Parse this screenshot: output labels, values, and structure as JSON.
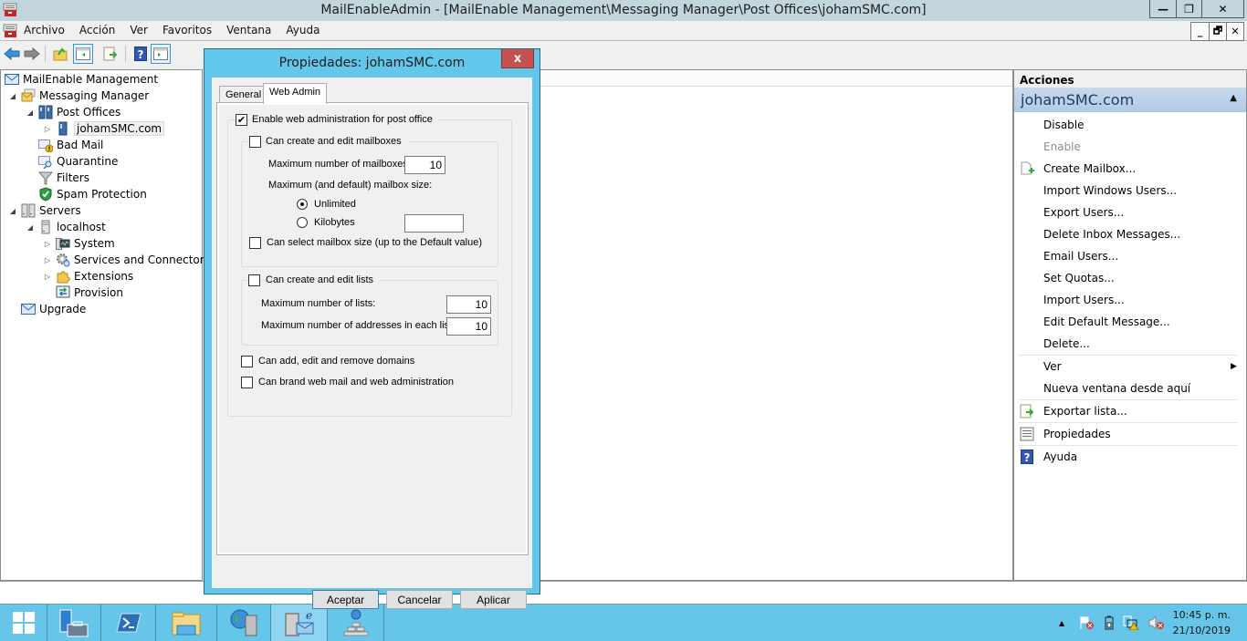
{
  "window": {
    "title": "MailEnableAdmin - [MailEnable Management\\Messaging Manager\\Post Offices\\johamSMC.com]",
    "controls": {
      "minimize": "—",
      "restore": "❐",
      "close": "✕"
    }
  },
  "menubar": {
    "items": [
      "Archivo",
      "Acción",
      "Ver",
      "Favoritos",
      "Ventana",
      "Ayuda"
    ],
    "mdi_controls": {
      "minimize": "_",
      "restore": "🗗",
      "close": "✕"
    }
  },
  "toolbar": {
    "buttons": [
      "back-arrow-icon",
      "forward-arrow-icon",
      "up-folder-icon",
      "show-hide-tree-icon",
      "export-list-icon",
      "help-icon",
      "show-hide-action-pane-icon"
    ]
  },
  "tree": {
    "nodes": [
      {
        "label": "MailEnable Management",
        "level": 0,
        "expander": "",
        "icon": "mailenable-icon"
      },
      {
        "label": "Messaging Manager",
        "level": 1,
        "expander": "◢",
        "icon": "messaging-icon"
      },
      {
        "label": "Post Offices",
        "level": 2,
        "expander": "◢",
        "icon": "post-offices-icon"
      },
      {
        "label": "johamSMC.com",
        "level": 3,
        "expander": "▷",
        "icon": "post-office-icon",
        "selected": true
      },
      {
        "label": "Bad Mail",
        "level": 2,
        "expander": "",
        "icon": "bad-mail-icon"
      },
      {
        "label": "Quarantine",
        "level": 2,
        "expander": "",
        "icon": "quarantine-icon"
      },
      {
        "label": "Filters",
        "level": 2,
        "expander": "",
        "icon": "filter-icon"
      },
      {
        "label": "Spam Protection",
        "level": 2,
        "expander": "",
        "icon": "shield-icon"
      },
      {
        "label": "Servers",
        "level": 1,
        "expander": "◢",
        "icon": "servers-icon"
      },
      {
        "label": "localhost",
        "level": 2,
        "expander": "◢",
        "icon": "server-icon"
      },
      {
        "label": "System",
        "level": 3,
        "expander": "▷",
        "icon": "system-icon"
      },
      {
        "label": "Services and Connectors",
        "level": 3,
        "expander": "▷",
        "icon": "gear-icon"
      },
      {
        "label": "Extensions",
        "level": 3,
        "expander": "▷",
        "icon": "puzzle-icon"
      },
      {
        "label": "Provision",
        "level": 3,
        "expander": "",
        "icon": "provision-icon"
      },
      {
        "label": "Upgrade",
        "level": 1,
        "expander": "",
        "icon": "mailenable-icon"
      }
    ]
  },
  "actions": {
    "header": "Acciones",
    "section_title": "johamSMC.com",
    "items": [
      {
        "label": "Disable",
        "icon": "",
        "disabled": false
      },
      {
        "label": "Enable",
        "icon": "",
        "disabled": true
      },
      {
        "label": "Create Mailbox...",
        "icon": "new-item-icon",
        "disabled": false
      },
      {
        "label": "Import Windows Users...",
        "icon": "",
        "disabled": false
      },
      {
        "label": "Export Users...",
        "icon": "",
        "disabled": false
      },
      {
        "label": "Delete Inbox Messages...",
        "icon": "",
        "disabled": false
      },
      {
        "label": "Email Users...",
        "icon": "",
        "disabled": false
      },
      {
        "label": "Set Quotas...",
        "icon": "",
        "disabled": false
      },
      {
        "label": "Import Users...",
        "icon": "",
        "disabled": false
      },
      {
        "label": "Edit Default Message...",
        "icon": "",
        "disabled": false
      },
      {
        "label": "Delete...",
        "icon": "",
        "disabled": false
      },
      {
        "label": "Ver",
        "icon": "",
        "disabled": false,
        "submenu": true
      },
      {
        "label": "Nueva ventana desde aquí",
        "icon": "",
        "disabled": false
      },
      {
        "label": "Exportar lista...",
        "icon": "export-list-icon",
        "disabled": false
      },
      {
        "label": "Propiedades",
        "icon": "properties-icon",
        "disabled": false
      },
      {
        "label": "Ayuda",
        "icon": "help-icon",
        "disabled": false
      }
    ]
  },
  "dialog": {
    "title": "Propiedades: johamSMC.com",
    "close_label": "x",
    "tabs": [
      {
        "label": "General",
        "active": false
      },
      {
        "label": "Web Admin",
        "active": true
      }
    ],
    "web_admin": {
      "enable_web_admin": {
        "label": "Enable web administration for post office",
        "checked": true
      },
      "mailboxes": {
        "label": "Can create and edit mailboxes",
        "checked": false,
        "max_mailboxes_label": "Maximum number of mailboxes:",
        "max_mailboxes_value": "10",
        "max_size_label": "Maximum (and default) mailbox size:",
        "unlimited_label": "Unlimited",
        "unlimited_selected": true,
        "kilobytes_label": "Kilobytes",
        "kilobytes_value": "",
        "select_size_label": "Can select mailbox size (up to the Default value)",
        "select_size_checked": false
      },
      "lists": {
        "label": "Can create and edit lists",
        "checked": false,
        "max_lists_label": "Maximum number of lists:",
        "max_lists_value": "10",
        "max_addresses_label": "Maximum number of addresses in each list:",
        "max_addresses_value": "10"
      },
      "domains": {
        "label": "Can add, edit and remove domains",
        "checked": false
      },
      "branding": {
        "label": "Can brand web mail and web administration",
        "checked": false
      }
    },
    "buttons": {
      "ok": "Aceptar",
      "cancel": "Cancelar",
      "apply": "Aplicar"
    }
  },
  "taskbar": {
    "apps": [
      "start-icon",
      "server-manager-icon",
      "powershell-icon",
      "file-explorer-icon",
      "iis-manager-icon",
      "mailenable-admin-icon",
      "network-icon"
    ],
    "tray": {
      "overflow": "▲"
    },
    "clock": {
      "time": "10:45 p. m.",
      "date": "21/10/2019"
    }
  },
  "colors": {
    "titlebar": "#c4d6dd",
    "dialog_frame": "#62c7ea",
    "close_button": "#c75050",
    "taskbar": "#65c6e9",
    "actions_section": "#b8d0ea"
  }
}
